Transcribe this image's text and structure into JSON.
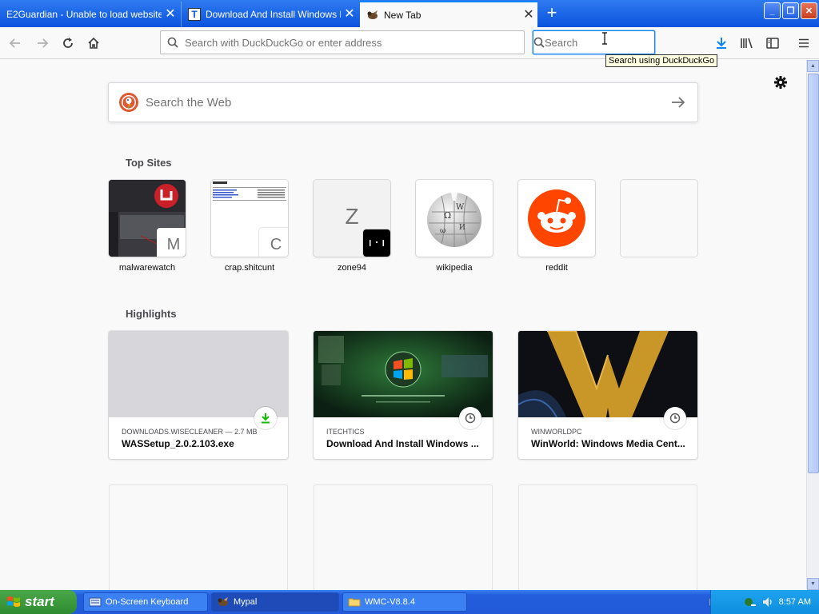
{
  "tabs": [
    {
      "title": "E2Guardian - Unable to load website",
      "active": false
    },
    {
      "title": "Download And Install Windows Me",
      "active": false,
      "favicon": "T"
    },
    {
      "title": "New Tab",
      "active": true
    }
  ],
  "nav": {
    "url_placeholder": "Search with DuckDuckGo or enter address",
    "search_placeholder": "Search",
    "search_tooltip": "Search using DuckDuckGo"
  },
  "newtab": {
    "web_search_placeholder": "Search the Web",
    "top_sites_title": "Top Sites",
    "top_sites": [
      {
        "label": "malwarewatch",
        "badge": "M"
      },
      {
        "label": "crap.shitcunt",
        "badge": "C"
      },
      {
        "label": "zone94",
        "letter": "Z"
      },
      {
        "label": "wikipedia"
      },
      {
        "label": "reddit"
      },
      {
        "label": ""
      }
    ],
    "highlights_title": "Highlights",
    "highlights": [
      {
        "source": "DOWNLOADS.WISECLEANER — 2.7 MB",
        "title": "WASSetup_2.0.2.103.exe",
        "badge": "download-icon"
      },
      {
        "source": "ITECHTICS",
        "title": "Download And Install Windows ...",
        "badge": "clock-icon"
      },
      {
        "source": "WINWORLDPC",
        "title": "WinWorld: Windows Media Cent...",
        "badge": "clock-icon"
      }
    ]
  },
  "taskbar": {
    "start_label": "start",
    "tasks": [
      {
        "label": "On-Screen Keyboard"
      },
      {
        "label": "Mypal"
      },
      {
        "label": "WMC-V8.8.4"
      }
    ],
    "clock": "8:57 AM"
  },
  "colors": {
    "tab_strip": "#0a52de",
    "accent": "#0a84ff",
    "download_green": "#12bc00",
    "reddit": "#ff4500",
    "start_green": "#3c9a3c"
  }
}
